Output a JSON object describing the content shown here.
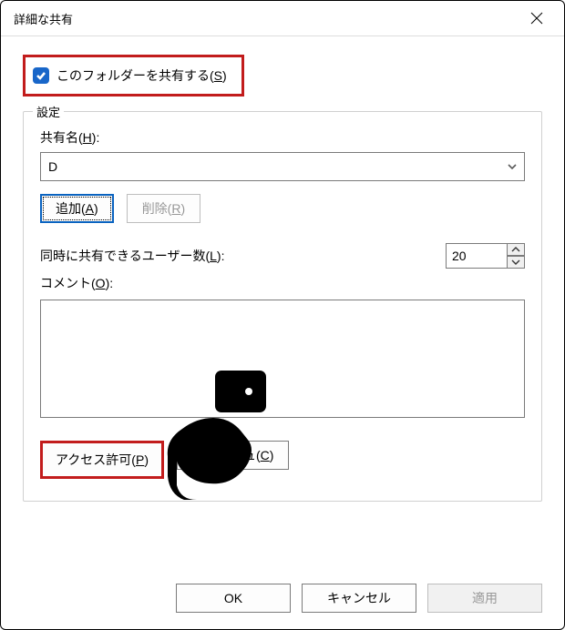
{
  "window": {
    "title": "詳細な共有"
  },
  "share_checkbox": {
    "checked": true,
    "label_prefix": "このフォルダーを共有する(",
    "label_mnemonic": "S",
    "label_suffix": ")"
  },
  "settings": {
    "legend": "設定",
    "share_name": {
      "label_prefix": "共有名(",
      "label_mnemonic": "H",
      "label_suffix": "):",
      "value": "D"
    },
    "add_button": {
      "prefix": "追加(",
      "mnemonic": "A",
      "suffix": ")"
    },
    "remove_button": {
      "prefix": "削除(",
      "mnemonic": "R",
      "suffix": ")"
    },
    "user_limit": {
      "label_prefix": "同時に共有できるユーザー数(",
      "label_mnemonic": "L",
      "label_suffix": "):",
      "value": "20"
    },
    "comment": {
      "label_prefix": "コメント(",
      "label_mnemonic": "O",
      "label_suffix": "):",
      "value": ""
    },
    "permissions_button": {
      "prefix": "アクセス許可(",
      "mnemonic": "P",
      "suffix": ")"
    },
    "cache_button": {
      "prefix": "キャッシュ(",
      "mnemonic": "C",
      "suffix": ")"
    }
  },
  "footer": {
    "ok": "OK",
    "cancel": "キャンセル",
    "apply": "適用"
  },
  "annotation": {
    "pointer_icon_name": "pointing-hand-icon"
  }
}
